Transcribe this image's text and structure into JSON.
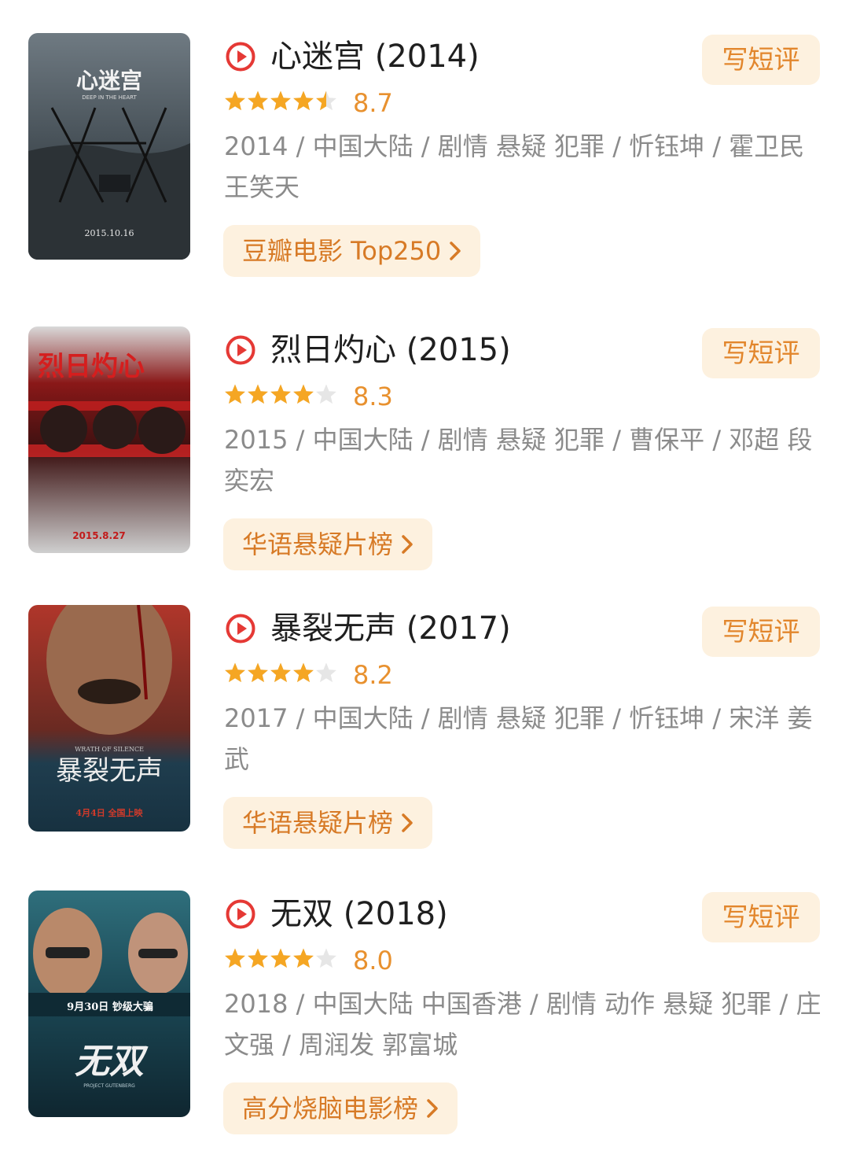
{
  "theme": {
    "accent": "#e2862c",
    "tag_bg": "#fdf1df",
    "play_red": "#e53935",
    "star_filled": "#f5a623",
    "star_empty": "#e6e6e6"
  },
  "icons": {
    "play": "play-circle-icon",
    "star": "star-icon",
    "chevron": "chevron-right-icon"
  },
  "movies": [
    {
      "title": "心迷宫 (2014)",
      "rating": "8.7",
      "stars": 4.5,
      "meta": "2014 / 中国大陆 / 剧情 悬疑 犯罪 / 忻钰坤 / 霍卫民 王笑天",
      "list_tag": "豆瓣电影 Top250",
      "review_label": "写短评",
      "poster": {
        "bg": "#4b555d",
        "title_text": "心迷宫",
        "subtitle_text": "DEEP IN THE HEART",
        "date_text": "2015.10.16"
      }
    },
    {
      "title": "烈日灼心 (2015)",
      "rating": "8.3",
      "stars": 4,
      "meta": "2015 / 中国大陆 / 剧情 悬疑 犯罪 / 曹保平 / 邓超 段奕宏",
      "list_tag": "华语悬疑片榜",
      "review_label": "写短评",
      "poster": {
        "bg": "#6b1c1c",
        "title_text": "烈日灼心",
        "date_text": "2015.8.27"
      }
    },
    {
      "title": "暴裂无声 (2017)",
      "rating": "8.2",
      "stars": 4,
      "meta": "2017 / 中国大陆 / 剧情 悬疑 犯罪 / 忻钰坤 / 宋洋 姜武",
      "list_tag": "华语悬疑片榜",
      "review_label": "写短评",
      "poster": {
        "bg": "#1d3b4c",
        "title_text": "暴裂无声",
        "subtitle_text": "WRATH OF SILENCE",
        "date_text": "4月4日 全国上映"
      }
    },
    {
      "title": "无双 (2018)",
      "rating": "8.0",
      "stars": 4,
      "meta": "2018 / 中国大陆 中国香港 / 剧情 动作 悬疑 犯罪 / 庄文强 / 周润发 郭富城",
      "list_tag": "高分烧脑电影榜",
      "review_label": "写短评",
      "poster": {
        "bg": "#163642",
        "title_text": "无双",
        "subtitle_text": "PROJECT GUTENBERG",
        "date_text": "9月30日 钞级大骗"
      }
    }
  ]
}
